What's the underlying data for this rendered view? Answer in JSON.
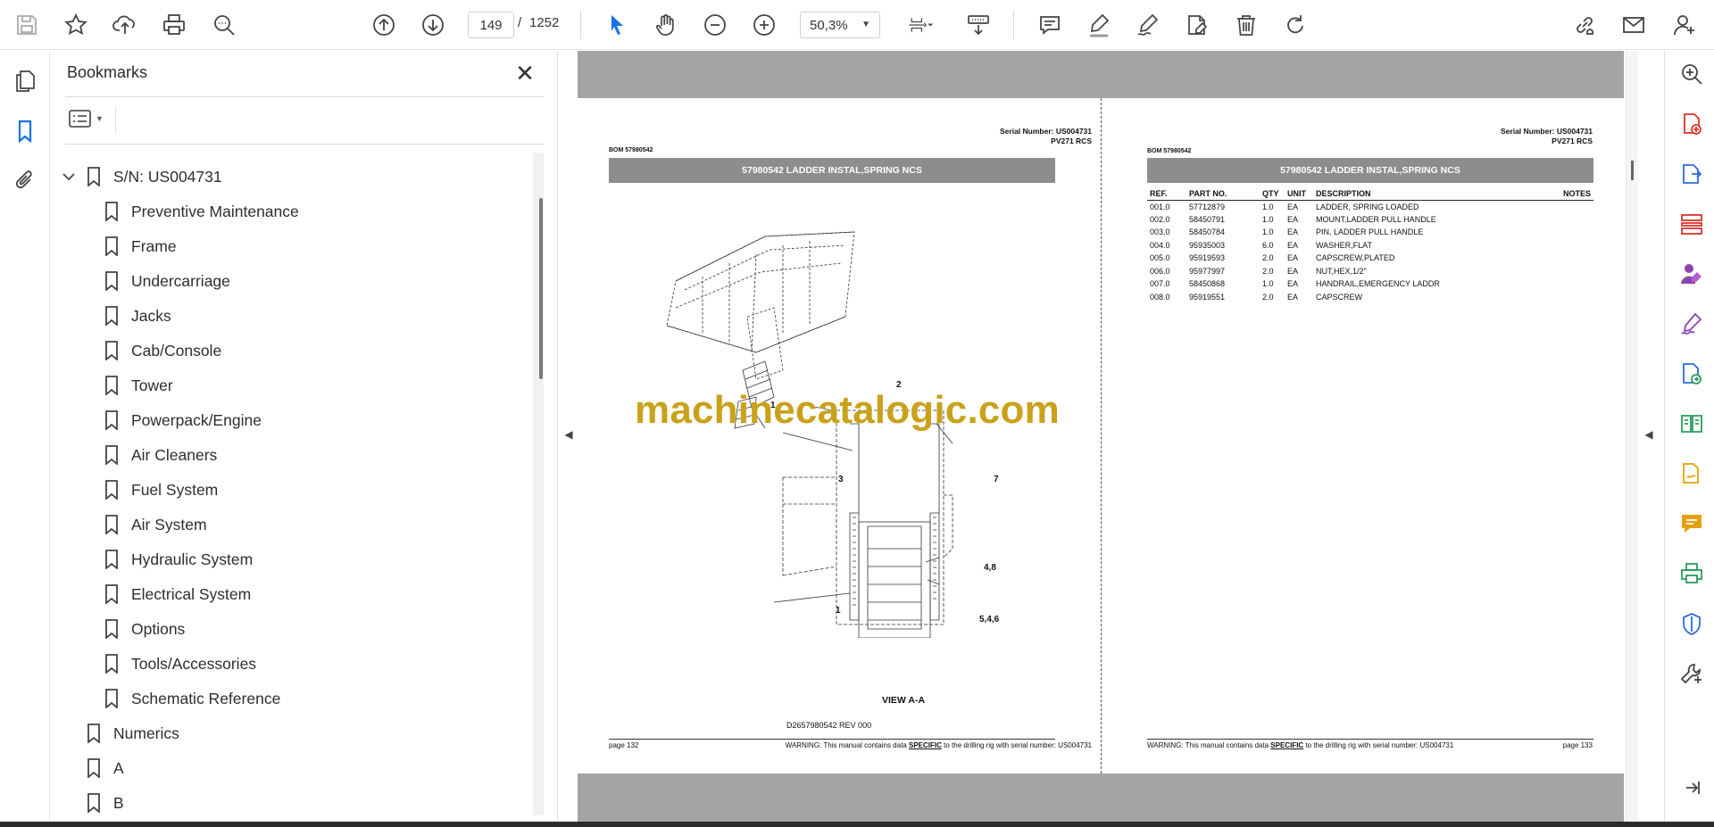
{
  "toolbar": {
    "current_page": "149",
    "page_separator": "/",
    "total_pages": "1252",
    "zoom": "50,3%"
  },
  "icons": {
    "top": [
      "save-icon",
      "star-icon",
      "upload-icon",
      "print-icon",
      "find-icon",
      "prev-page-icon",
      "next-page-icon",
      "select-cursor-icon",
      "hand-icon",
      "zoom-out-icon",
      "zoom-in-icon",
      "page-fit-icon",
      "scroll-mode-icon",
      "comment-icon",
      "highlight-icon",
      "sign-icon",
      "fill-sign-icon",
      "delete-icon",
      "rotate-icon",
      "share-link-icon",
      "mail-icon",
      "account-icon"
    ],
    "right": [
      "zoom-tool-icon",
      "create-pdf-icon",
      "export-pdf-icon",
      "organize-pages-icon",
      "edit-pdf-icon",
      "fill-sign-icon",
      "send-for-review-icon",
      "compare-icon",
      "request-signature-icon",
      "comment-tool-icon",
      "print-production-icon",
      "protect-icon",
      "more-tools-icon",
      "collapse-panel-icon"
    ]
  },
  "accent_color": "#1473e6",
  "bookmarks": {
    "title": "Bookmarks",
    "root": "S/N: US004731",
    "children": [
      "Preventive Maintenance",
      "Frame",
      "Undercarriage",
      "Jacks",
      "Cab/Console",
      "Tower",
      "Powerpack/Engine",
      "Air Cleaners",
      "Fuel System",
      "Air System",
      "Hydraulic System",
      "Electrical System",
      "Options",
      "Tools/Accessories",
      "Schematic Reference"
    ],
    "top_level": [
      "Numerics",
      "A",
      "B"
    ]
  },
  "page_left": {
    "serial": "Serial Number: US004731",
    "model": "PV271 RCS",
    "bom": "BOM 57980542",
    "banner": "57980542 LADDER INSTAL,SPRING NCS",
    "drawing_labels": [
      "1",
      "2",
      "3",
      "7",
      "4,8",
      "1",
      "5,4,6"
    ],
    "view_label": "VIEW A-A",
    "drawing_no": "D2657980542 REV 000",
    "page": "page 132",
    "warning_prefix": "WARNING:  This manual contains data",
    "warning_em": "SPECIFIC",
    "warning_suffix": "to the drilling rig with serial number: US004731"
  },
  "page_right": {
    "serial": "Serial Number: US004731",
    "model": "PV271 RCS",
    "bom": "BOM 57980542",
    "banner": "57980542 LADDER INSTAL,SPRING NCS",
    "columns": [
      "REF.",
      "PART NO.",
      "QTY",
      "UNIT",
      "DESCRIPTION",
      "NOTES"
    ],
    "rows": [
      [
        "001.0",
        "57712879",
        "1.0",
        "EA",
        "LADDER, SPRING LOADED",
        ""
      ],
      [
        "002.0",
        "58450791",
        "1.0",
        "EA",
        "MOUNT,LADDER PULL HANDLE",
        ""
      ],
      [
        "003.0",
        "58450784",
        "1.0",
        "EA",
        "PIN, LADDER PULL HANDLE",
        ""
      ],
      [
        "004.0",
        "95935003",
        "6.0",
        "EA",
        "WASHER,FLAT",
        ""
      ],
      [
        "005.0",
        "95919593",
        "2.0",
        "EA",
        "CAPSCREW,PLATED",
        ""
      ],
      [
        "006.0",
        "95977997",
        "2.0",
        "EA",
        "NUT,HEX,1/2\"",
        ""
      ],
      [
        "007.0",
        "58450868",
        "1.0",
        "EA",
        "HANDRAIL,EMERGENCY LADDR",
        ""
      ],
      [
        "008.0",
        "95919551",
        "2.0",
        "EA",
        "CAPSCREW",
        ""
      ]
    ],
    "page": "page 133",
    "warning_prefix": "WARNING:  This manual contains data",
    "warning_em": "SPECIFIC",
    "warning_suffix": "to the drilling rig with serial number: US004731"
  },
  "watermark": "machinecatalogic.com"
}
